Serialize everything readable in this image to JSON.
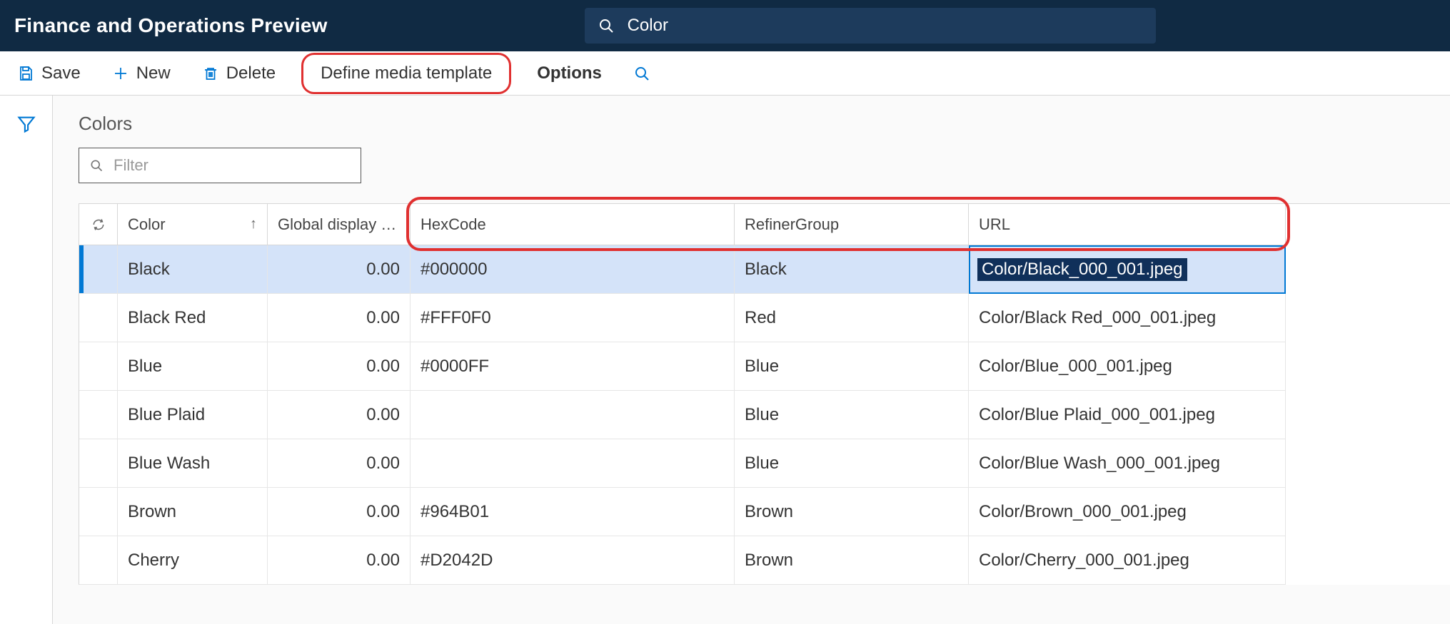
{
  "header": {
    "title": "Finance and Operations Preview"
  },
  "search": {
    "value": "Color"
  },
  "actions": {
    "save": "Save",
    "new": "New",
    "delete": "Delete",
    "define_media_template": "Define media template",
    "options": "Options"
  },
  "page": {
    "title": "Colors"
  },
  "filter": {
    "placeholder": "Filter"
  },
  "columns": {
    "color": "Color",
    "global_display": "Global display …",
    "hexcode": "HexCode",
    "refinergroup": "RefinerGroup",
    "url": "URL"
  },
  "rows": [
    {
      "color": "Black",
      "global_display": "0.00",
      "hexcode": "#000000",
      "refinergroup": "Black",
      "url": "Color/Black_000_001.jpeg",
      "selected": true
    },
    {
      "color": "Black Red",
      "global_display": "0.00",
      "hexcode": "#FFF0F0",
      "refinergroup": "Red",
      "url": "Color/Black Red_000_001.jpeg"
    },
    {
      "color": "Blue",
      "global_display": "0.00",
      "hexcode": "#0000FF",
      "refinergroup": "Blue",
      "url": "Color/Blue_000_001.jpeg"
    },
    {
      "color": "Blue Plaid",
      "global_display": "0.00",
      "hexcode": "",
      "refinergroup": "Blue",
      "url": "Color/Blue Plaid_000_001.jpeg"
    },
    {
      "color": "Blue Wash",
      "global_display": "0.00",
      "hexcode": "",
      "refinergroup": "Blue",
      "url": "Color/Blue Wash_000_001.jpeg"
    },
    {
      "color": "Brown",
      "global_display": "0.00",
      "hexcode": "#964B01",
      "refinergroup": "Brown",
      "url": "Color/Brown_000_001.jpeg"
    },
    {
      "color": "Cherry",
      "global_display": "0.00",
      "hexcode": "#D2042D",
      "refinergroup": "Brown",
      "url": "Color/Cherry_000_001.jpeg"
    }
  ],
  "icons": {
    "search": "search-icon",
    "save": "save-icon",
    "new": "plus-icon",
    "delete": "trash-icon",
    "filter_funnel": "funnel-icon",
    "refresh": "refresh-icon",
    "sort_up": "arrow-up-icon"
  }
}
